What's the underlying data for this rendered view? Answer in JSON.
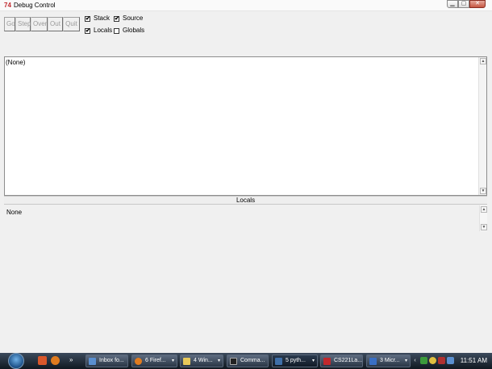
{
  "window": {
    "title": "Debug Control",
    "app_icon": "74"
  },
  "toolbar": {
    "go": "Go",
    "step": "Step",
    "over": "Over",
    "out": "Out",
    "quit": "Quit"
  },
  "options": {
    "stack": {
      "label": "Stack",
      "checked": true
    },
    "source": {
      "label": "Source",
      "checked": true
    },
    "locals": {
      "label": "Locals",
      "checked": true
    },
    "globals": {
      "label": "Globals",
      "checked": false
    }
  },
  "stack_pane": {
    "text": "(None)"
  },
  "locals_pane": {
    "header": "Locals",
    "text": "None"
  },
  "taskbar": {
    "chevron": "»",
    "tasks": [
      "Inbox fo...",
      "6 Firef...",
      "4 Win...",
      "Comma...",
      "5 pyth...",
      "CS221La...",
      "3 Micr..."
    ],
    "clock": "11:51 AM",
    "check_mark": "✔"
  }
}
